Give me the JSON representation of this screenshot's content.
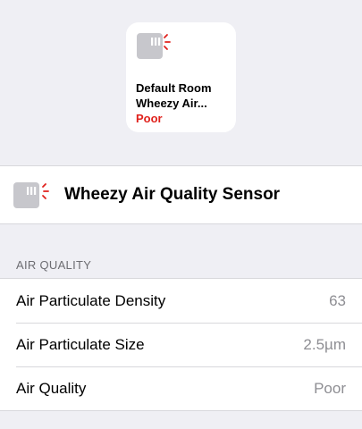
{
  "tile": {
    "icon": "air-quality-sensor-icon",
    "room": "Default Room",
    "name": "Wheezy Air...",
    "status": "Poor",
    "status_color": "#e0211c"
  },
  "accessory": {
    "icon": "air-quality-sensor-icon",
    "name": "Wheezy Air Quality Sensor"
  },
  "section": {
    "title": "AIR QUALITY"
  },
  "rows": [
    {
      "label": "Air Particulate Density",
      "value": "63"
    },
    {
      "label": "Air Particulate Size",
      "value": "2.5µm"
    },
    {
      "label": "Air Quality",
      "value": "Poor"
    }
  ],
  "colors": {
    "background": "#efeff4",
    "alert": "#e0211c",
    "secondary_text": "#8e8e93"
  }
}
